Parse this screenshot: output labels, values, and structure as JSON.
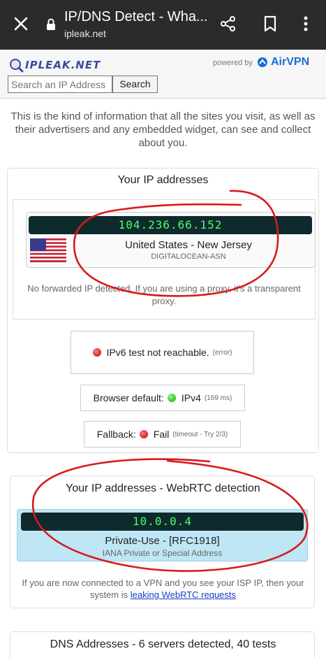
{
  "browser": {
    "title": "IP/DNS Detect - Wha...",
    "url": "ipleak.net",
    "icons": [
      "close-icon",
      "lock-icon",
      "share-icon",
      "bookmark-icon",
      "more-vert-icon"
    ]
  },
  "header": {
    "logo_text": "IPLEAK.NET",
    "powered_by": "powered by",
    "sponsor": "AirVPN",
    "search_placeholder": "Search an IP Address",
    "search_button": "Search"
  },
  "intro": "This is the kind of information that all the sites you visit, as well as their advertisers and any embedded widget, can see and collect about you.",
  "ip_section": {
    "title": "Your IP addresses",
    "ip": "104.236.66.152",
    "location": "United States - New Jersey",
    "asn": "DIGITALOCEAN-ASN",
    "no_forward": "No forwarded IP detected. If you are using a proxy, it's a transparent proxy.",
    "ipv6_label": "IPv6 test not reachable.",
    "ipv6_note": "(error)",
    "browser_default_label": "Browser default:",
    "browser_default_value": "IPv4",
    "browser_default_note": "(169 ms)",
    "fallback_label": "Fallback:",
    "fallback_value": "Fail",
    "fallback_note": "(timeout - Try 2/3)"
  },
  "webrtc_section": {
    "title": "Your IP addresses - WebRTC detection",
    "ip": "10.0.0.4",
    "type": "Private-Use - [RFC1918]",
    "note": "IANA Private or Special Address",
    "vpn_text": "If you are now connected to a VPN and you see your ISP IP, then your system is",
    "vpn_link": "leaking WebRTC requests"
  },
  "dns_section": {
    "title": "DNS Addresses - 6 servers detected, 40 tests"
  },
  "colors": {
    "chrome_bar": "#2b2b2b",
    "ip_display_bg": "#0f2a2c",
    "ip_display_text": "#4dff6a",
    "webrtc_bg": "#bfe6f5",
    "annotation": "#d81b1b",
    "link": "#1a3cc8"
  }
}
